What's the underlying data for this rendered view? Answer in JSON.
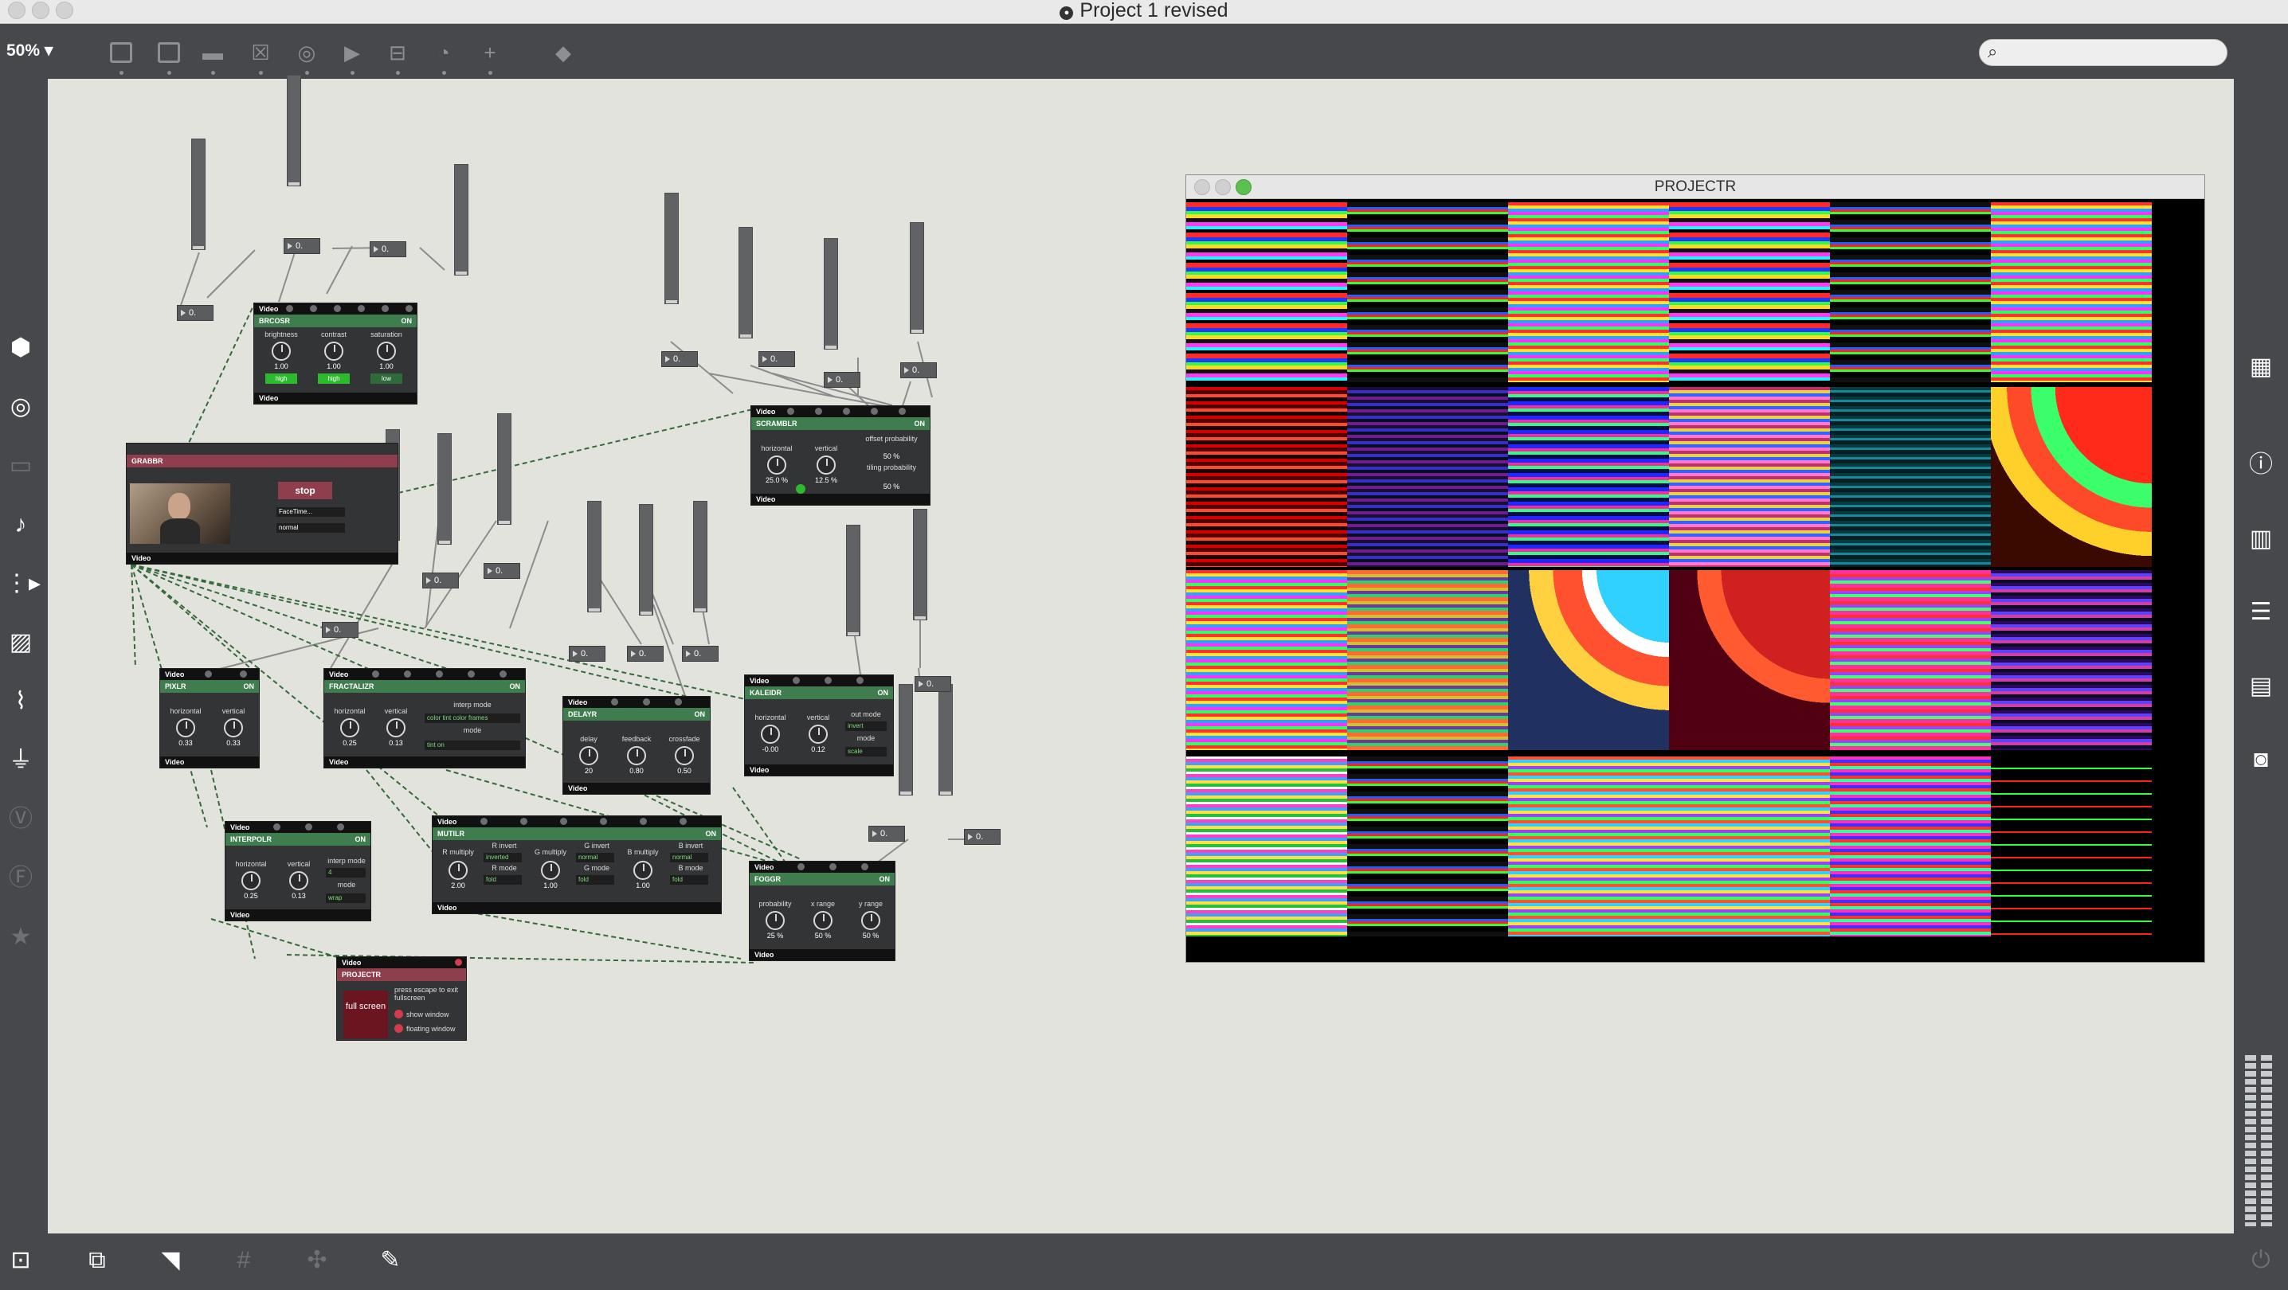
{
  "window": {
    "title": "Project 1 revised",
    "controls": [
      "close",
      "minimize",
      "zoom"
    ]
  },
  "toolbar": {
    "zoom": "50% ▾",
    "tools": [
      "new-object-icon",
      "message-icon",
      "comment-icon",
      "toggle-icon",
      "button-icon",
      "bang-icon",
      "slider-icon",
      "dial-icon",
      "add-icon",
      "paint-bucket-icon"
    ],
    "search_placeholder": ""
  },
  "left_sidebar": [
    "cube-icon",
    "target-icon",
    "patcher-icon",
    "music-note-icon",
    "step-icon",
    "image-icon",
    "clip-icon",
    "plug-icon",
    "v-icon",
    "f-icon",
    "star-icon"
  ],
  "right_sidebar": [
    "grid-icon",
    "info-icon",
    "book-icon",
    "list-icon",
    "reference-icon",
    "camera-icon"
  ],
  "bottom_bar": [
    "lock-icon",
    "presentation-icon",
    "comment-bubble-icon",
    "grid-toggle-icon",
    "snap-icon",
    "wrench-icon",
    "power-icon"
  ],
  "number_boxes": [
    "0.",
    "0.",
    "0.",
    "0.",
    "0.",
    "0.",
    "0.",
    "0.",
    "0.",
    "0.",
    "0.",
    "0.",
    "0.",
    "0.",
    "0.",
    "0."
  ],
  "modules": {
    "brcosr": {
      "header": "Video",
      "title": "BRCOSR",
      "state": "ON",
      "knobs": [
        {
          "label": "brightness",
          "value": "1.00"
        },
        {
          "label": "contrast",
          "value": "1.00"
        },
        {
          "label": "saturation",
          "value": "1.00"
        }
      ],
      "buttons": [
        "high",
        "high",
        "low"
      ],
      "footer": "Video"
    },
    "grabbr": {
      "title": "GRABBR",
      "stop_label": "stop",
      "device": "FaceTime...",
      "mode": "normal",
      "footer": "Video"
    },
    "scramblr": {
      "header": "Video",
      "title": "SCRAMBLR",
      "state": "ON",
      "knobs": [
        {
          "label": "horizontal",
          "value": "25.0 %"
        },
        {
          "label": "vertical",
          "value": "12.5 %"
        }
      ],
      "offset_label": "offset probability",
      "offset_value": "50 %",
      "tiling_label": "tiling probability",
      "tiling_value": "50 %",
      "footer": "Video"
    },
    "pixlr": {
      "header": "Video",
      "title": "PIXLR",
      "state": "ON",
      "knobs": [
        {
          "label": "horizontal",
          "value": "0.33"
        },
        {
          "label": "vertical",
          "value": "0.33"
        }
      ],
      "footer": "Video"
    },
    "fractalizr": {
      "header": "Video",
      "title": "FRACTALIZR",
      "state": "ON",
      "knobs": [
        {
          "label": "horizontal",
          "value": "0.25"
        },
        {
          "label": "vertical",
          "value": "0.13"
        }
      ],
      "interp_label": "interp mode",
      "interp_value": "color tint color frames",
      "mode_label": "mode",
      "mode_value": "tint on",
      "footer": "Video"
    },
    "delayr": {
      "header": "Video",
      "title": "DELAYR",
      "state": "ON",
      "knobs": [
        {
          "label": "delay",
          "value": "20"
        },
        {
          "label": "feedback",
          "value": "0.80"
        },
        {
          "label": "crossfade",
          "value": "0.50"
        }
      ],
      "footer": "Video"
    },
    "kaleidr": {
      "header": "Video",
      "title": "KALEIDR",
      "state": "ON",
      "knobs": [
        {
          "label": "horizontal",
          "value": "-0.00"
        },
        {
          "label": "vertical",
          "value": "0.12"
        }
      ],
      "out_label": "out mode",
      "out_value": "invert",
      "mode_label": "mode",
      "mode_value": "scale",
      "footer": "Video"
    },
    "interpolr": {
      "header": "Video",
      "title": "INTERPOLR",
      "state": "ON",
      "knobs": [
        {
          "label": "horizontal",
          "value": "0.25"
        },
        {
          "label": "vertical",
          "value": "0.13"
        }
      ],
      "interp_label": "interp mode",
      "interp_value": "4",
      "mode_label": "mode",
      "mode_value": "wrap",
      "footer": "Video"
    },
    "mutilr": {
      "header": "Video",
      "title": "MUTILR",
      "state": "ON",
      "knobs": [
        {
          "label": "R multiply",
          "value": "2.00"
        },
        {
          "label": "G multiply",
          "value": "1.00"
        },
        {
          "label": "B multiply",
          "value": "1.00"
        }
      ],
      "r_invert": "R invert",
      "r_invert_value": "inverted",
      "r_mode": "R mode",
      "r_mode_value": "fold",
      "g_invert": "G invert",
      "g_invert_value": "normal",
      "g_mode": "G mode",
      "g_mode_value": "fold",
      "b_invert": "B invert",
      "b_invert_value": "normal",
      "b_mode": "B mode",
      "b_mode_value": "fold",
      "footer": "Video"
    },
    "foggr": {
      "header": "Video",
      "title": "FOGGR",
      "state": "ON",
      "knobs": [
        {
          "label": "probability",
          "value": "25 %"
        },
        {
          "label": "x range",
          "value": "50 %"
        },
        {
          "label": "y range",
          "value": "50 %"
        }
      ],
      "footer": "Video"
    },
    "projectr_module": {
      "header": "Video",
      "title": "PROJECTR",
      "fullscreen_label": "full screen",
      "note": "press escape to exit fullscreen",
      "show_window": "show window",
      "floating_window": "floating window"
    }
  },
  "projectr_window": {
    "title": "PROJECTR"
  }
}
